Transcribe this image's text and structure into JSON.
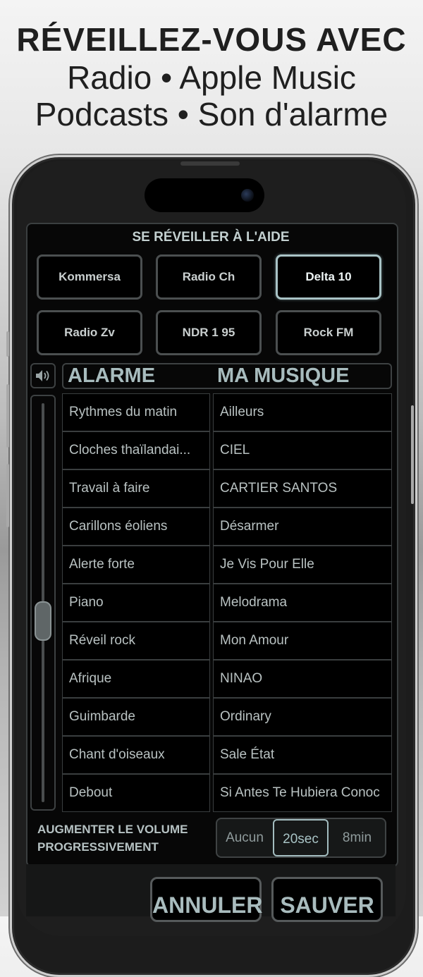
{
  "headline": {
    "line1": "RÉVEILLEZ-VOUS AVEC",
    "line2": "Radio • Apple Music",
    "line3": "Podcasts • Son d'alarme"
  },
  "panel": {
    "title": "SE RÉVEILLER À L'AIDE",
    "stations": [
      {
        "label": "Kommersa",
        "selected": false
      },
      {
        "label": "Radio Ch",
        "selected": false
      },
      {
        "label": "Delta 10",
        "selected": true
      },
      {
        "label": "Radio Zv",
        "selected": false
      },
      {
        "label": "NDR 1 95",
        "selected": false
      },
      {
        "label": "Rock FM",
        "selected": false
      }
    ],
    "volume_icon": "speaker-icon",
    "volume_level": 0.45,
    "tabs": {
      "alarm": "ALARME",
      "music": "MA MUSIQUE"
    },
    "alarm_sounds": [
      "Rythmes du matin",
      "Cloches thaïlandai...",
      "Travail à faire",
      "Carillons éoliens",
      "Alerte forte",
      "Piano",
      "Réveil rock",
      "Afrique",
      "Guimbarde",
      "Chant d'oiseaux",
      "Debout"
    ],
    "music_tracks": [
      "Ailleurs",
      "CIEL",
      "CARTIER SANTOS",
      "Désarmer",
      "Je Vis Pour Elle",
      "Melodrama",
      "Mon Amour",
      "NINAO",
      "Ordinary",
      "Sale État",
      "Si Antes Te Hubiera Conoc"
    ],
    "ramp": {
      "label_line1": "AUGMENTER LE VOLUME",
      "label_line2": "PROGRESSIVEMENT",
      "options": [
        "Aucun",
        "20sec",
        "8min"
      ],
      "selected": "20sec"
    }
  },
  "actions": {
    "cancel": "ANNULER",
    "save": "SAUVER"
  },
  "colors": {
    "accent": "#a9c3c6",
    "panel_bg": "#070707",
    "text": "#b9c2c2"
  }
}
